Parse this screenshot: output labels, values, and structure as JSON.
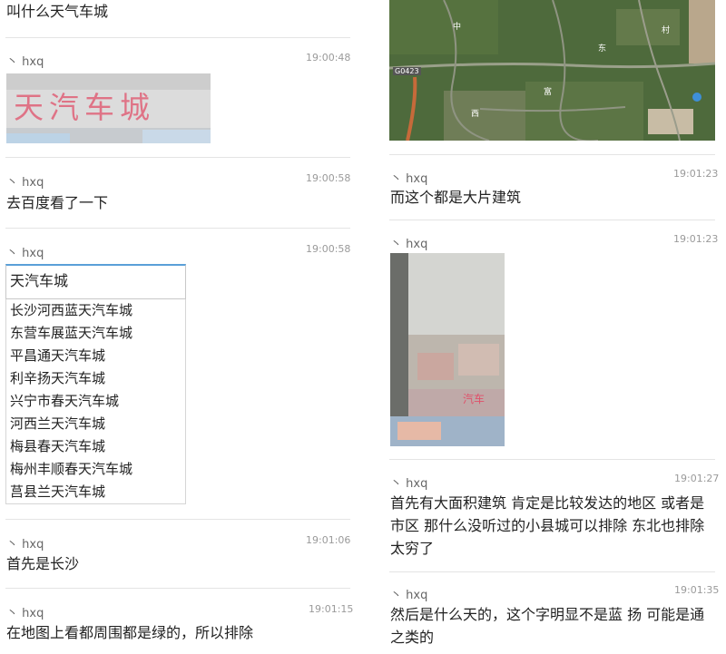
{
  "left": {
    "top_text": "叫什么天气车城",
    "messages": [
      {
        "user": "丶 hxq",
        "time": "19:00:48"
      },
      {
        "user": "丶 hxq",
        "time": "19:00:58",
        "text": "去百度看了一下"
      },
      {
        "user": "丶 hxq",
        "time": "19:00:58"
      },
      {
        "user": "丶 hxq",
        "time": "19:01:06",
        "text": "首先是长沙"
      },
      {
        "user": "丶 hxq",
        "time": "19:01:15",
        "text": "在地图上看都周围都是绿的，所以排除"
      }
    ],
    "photo_text": "天汽车城",
    "search": {
      "value": "天汽车城",
      "suggestions": [
        "长沙河西蓝天汽车城",
        "东营车展蓝天汽车城",
        "平昌通天汽车城",
        "利辛扬天汽车城",
        "兴宁市春天汽车城",
        "河西兰天汽车城",
        "梅县春天汽车城",
        "梅州丰顺春天汽车城",
        "莒县兰天汽车城"
      ]
    }
  },
  "right": {
    "map_labels": [
      "G0423",
      "中",
      "东",
      "富",
      "西",
      "村"
    ],
    "messages": [
      {
        "user": "丶 hxq",
        "time": "19:01:23",
        "text": "而这个都是大片建筑"
      },
      {
        "user": "丶 hxq",
        "time": "19:01:23"
      },
      {
        "user": "丶 hxq",
        "time": "19:01:27",
        "text": "首先有大面积建筑 肯定是比较发达的地区 或者是市区 那什么没听过的小县城可以排除 东北也排除 太穷了"
      },
      {
        "user": "丶 hxq",
        "time": "19:01:35",
        "text": "然后是什么天的，这个字明显不是蓝 扬 可能是通之类的"
      }
    ],
    "street_sign_text": "汽车"
  },
  "colors": {
    "accent": "#5aa0d8",
    "sign_red": "#e0506a",
    "map_green": "#4e6a3c"
  }
}
